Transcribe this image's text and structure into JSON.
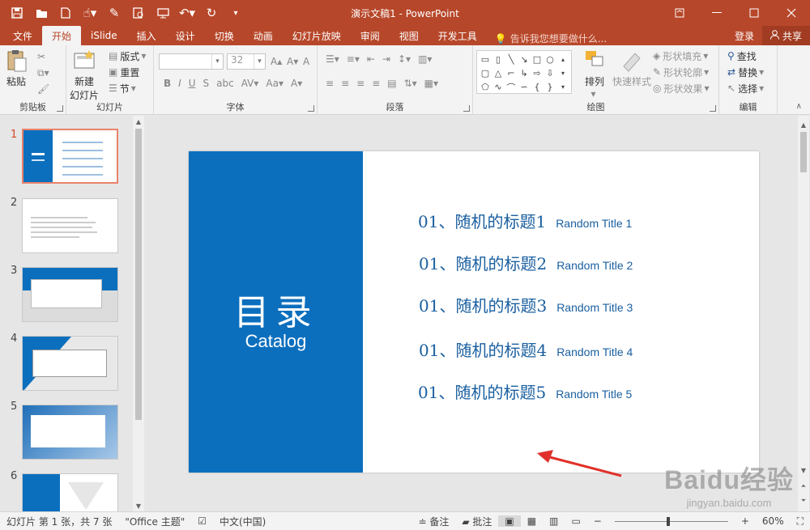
{
  "window": {
    "title": "演示文稿1 - PowerPoint"
  },
  "qat": {
    "icons": [
      "save-icon",
      "open-icon",
      "new-icon",
      "touch-icon",
      "brush-icon",
      "preview-icon",
      "present-icon",
      "undo-icon",
      "redo-icon",
      "customize-icon"
    ]
  },
  "tabs": [
    "文件",
    "开始",
    "iSlide",
    "插入",
    "设计",
    "切换",
    "动画",
    "幻灯片放映",
    "审阅",
    "视图",
    "开发工具"
  ],
  "active_tab": "开始",
  "tell_me": "告诉我您想要做什么...",
  "account": {
    "login": "登录",
    "share": "共享"
  },
  "ribbon": {
    "clipboard": {
      "label": "剪贴板",
      "paste": "粘贴"
    },
    "slides": {
      "label": "幻灯片",
      "new_slide_line1": "新建",
      "new_slide_line2": "幻灯片",
      "layout": "版式",
      "reset": "重置",
      "section": "节"
    },
    "font": {
      "label": "字体",
      "font_name": "",
      "font_size": "32"
    },
    "paragraph": {
      "label": "段落"
    },
    "drawing": {
      "label": "绘图",
      "arrange": "排列",
      "quick_styles": "快速样式",
      "shape_fill": "形状填充",
      "shape_outline": "形状轮廓",
      "shape_effects": "形状效果"
    },
    "editing": {
      "label": "编辑",
      "find": "查找",
      "replace": "替换",
      "select": "选择"
    }
  },
  "thumbnails": [
    {
      "number": "1",
      "selected": true
    },
    {
      "number": "2",
      "selected": false
    },
    {
      "number": "3",
      "selected": false
    },
    {
      "number": "4",
      "selected": false
    },
    {
      "number": "5",
      "selected": false
    },
    {
      "number": "6",
      "selected": false
    }
  ],
  "slide": {
    "title": "目录",
    "subtitle": "Catalog",
    "items": [
      {
        "cn": "01、随机的标题1",
        "en": "Random Title 1"
      },
      {
        "cn": "01、随机的标题2",
        "en": "Random Title 2"
      },
      {
        "cn": "01、随机的标题3",
        "en": "Random Title 3"
      },
      {
        "cn": "01、随机的标题4",
        "en": "Random Title 4"
      },
      {
        "cn": "01、随机的标题5",
        "en": "Random Title 5"
      }
    ]
  },
  "status": {
    "slide_info": "幻灯片 第 1 张，共 7 张",
    "theme": "\"Office 主题\"",
    "language": "中文(中国)",
    "notes": "备注",
    "comments": "批注",
    "zoom": "60%"
  },
  "watermark": {
    "brand": "Baidu经验",
    "url": "jingyan.baidu.com"
  },
  "colors": {
    "accent": "#b7472a",
    "slide_blue": "#0b6fbe",
    "toc_text": "#1a5fa0",
    "arrow": "#e0312a"
  }
}
